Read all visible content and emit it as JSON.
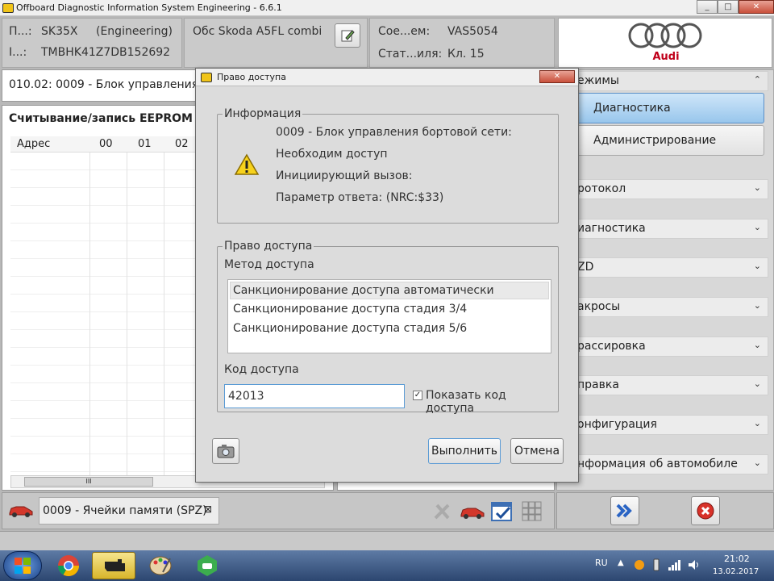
{
  "window": {
    "title": "Offboard Diagnostic Information System Engineering - 6.6.1",
    "min": "_",
    "max": "□",
    "close": "✕"
  },
  "header": {
    "p_label": "П...:",
    "p_value": "SK35X",
    "p_mode": "(Engineering)",
    "i_label": "I...:",
    "i_value": "TMBHK41Z7DB152692",
    "obs": "Обс Skoda A5FL combi",
    "soe_label": "Сое...ем:",
    "soe_value": "VAS5054",
    "stat_label": "Стат...иля:",
    "stat_value": "Кл. 15",
    "brand": "Audi"
  },
  "main": {
    "section_title": "010.02:  0009 - Блок управления",
    "eeprom_title": "Считывание/запись EEPROM",
    "table_headers": [
      "Адрес",
      "00",
      "01",
      "02"
    ],
    "scroll_grip": "III"
  },
  "sidebar": {
    "modes_label": "ежимы",
    "diag_btn": "Диагностика",
    "admin_btn": "Администрирование",
    "items": [
      "ротокол",
      "иагностика",
      "ZD",
      "акросы",
      "рассировка",
      "правка",
      "онфигурация",
      "нформация об автомобиле"
    ]
  },
  "dialog": {
    "title": "Право доступа",
    "info_group": "Информация",
    "info_lines": [
      "0009 - Блок управления бортовой сети:",
      "Необходим доступ",
      "Инициирующий вызов:",
      "Параметр ответа: (NRC:$33)"
    ],
    "access_group": "Право доступа",
    "method_label": "Метод доступа",
    "methods": [
      "Санкционирование доступа автоматически",
      "Санкционирование доступа стадия 3/4",
      "Санкционирование доступа стадия 5/6"
    ],
    "code_label": "Код доступа",
    "code_value": "42013",
    "show_code": "Показать код доступа",
    "execute": "Выполнить",
    "cancel": "Отмена",
    "close": "✕"
  },
  "bottom": {
    "tab_label": "0009 - Ячейки памяти (SPZ)",
    "tab_close": "⊠"
  },
  "tray": {
    "lang": "RU",
    "time": "21:02",
    "date": "13.02.2017"
  }
}
